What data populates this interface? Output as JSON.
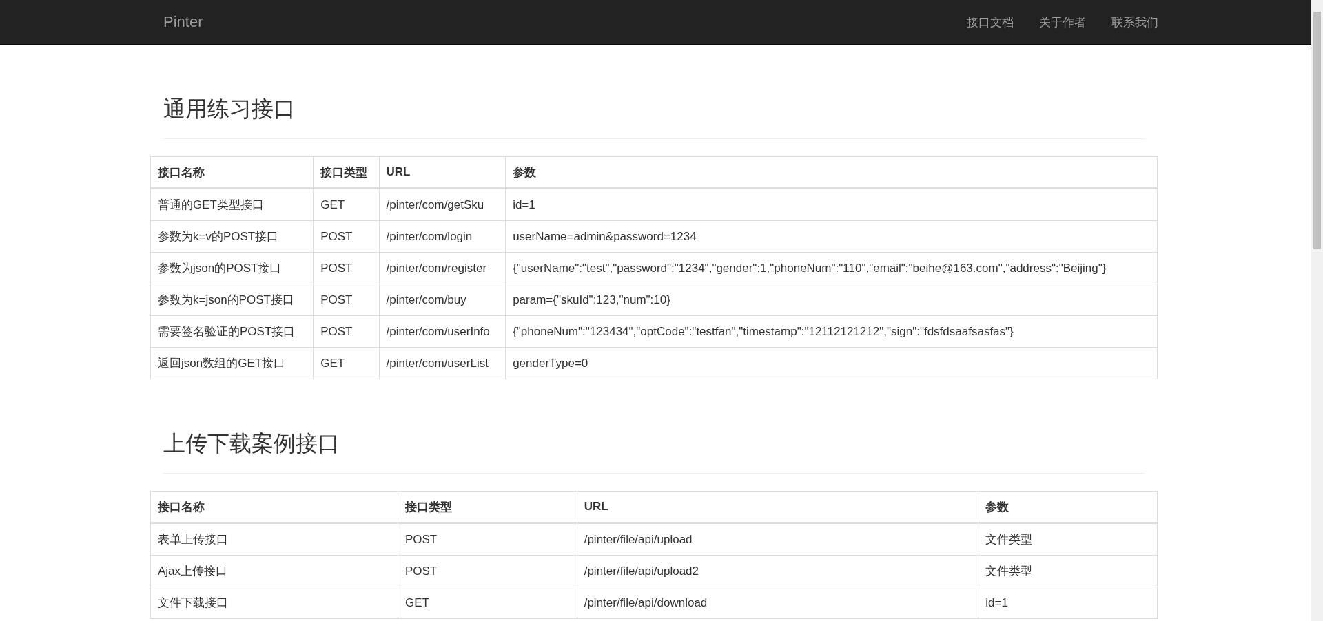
{
  "navbar": {
    "brand": "Pinter",
    "links": [
      "接口文档",
      "关于作者",
      "联系我们"
    ]
  },
  "sections": [
    {
      "title": "通用练习接口",
      "columns": [
        "接口名称",
        "接口类型",
        "URL",
        "参数"
      ],
      "rows": [
        [
          "普通的GET类型接口",
          "GET",
          "/pinter/com/getSku",
          "id=1"
        ],
        [
          "参数为k=v的POST接口",
          "POST",
          "/pinter/com/login",
          "userName=admin&password=1234"
        ],
        [
          "参数为json的POST接口",
          "POST",
          "/pinter/com/register",
          "{\"userName\":\"test\",\"password\":\"1234\",\"gender\":1,\"phoneNum\":\"110\",\"email\":\"beihe@163.com\",\"address\":\"Beijing\"}"
        ],
        [
          "参数为k=json的POST接口",
          "POST",
          "/pinter/com/buy",
          "param={\"skuId\":123,\"num\":10}"
        ],
        [
          "需要签名验证的POST接口",
          "POST",
          "/pinter/com/userInfo",
          "{\"phoneNum\":\"123434\",\"optCode\":\"testfan\",\"timestamp\":\"12112121212\",\"sign\":\"fdsfdsaafsasfas\"}"
        ],
        [
          "返回json数组的GET接口",
          "GET",
          "/pinter/com/userList",
          "genderType=0"
        ]
      ]
    },
    {
      "title": "上传下载案例接口",
      "columns": [
        "接口名称",
        "接口类型",
        "URL",
        "参数"
      ],
      "rows": [
        [
          "表单上传接口",
          "POST",
          "/pinter/file/api/upload",
          "文件类型"
        ],
        [
          "Ajax上传接口",
          "POST",
          "/pinter/file/api/upload2",
          "文件类型"
        ],
        [
          "文件下载接口",
          "GET",
          "/pinter/file/api/download",
          "id=1"
        ]
      ]
    }
  ]
}
